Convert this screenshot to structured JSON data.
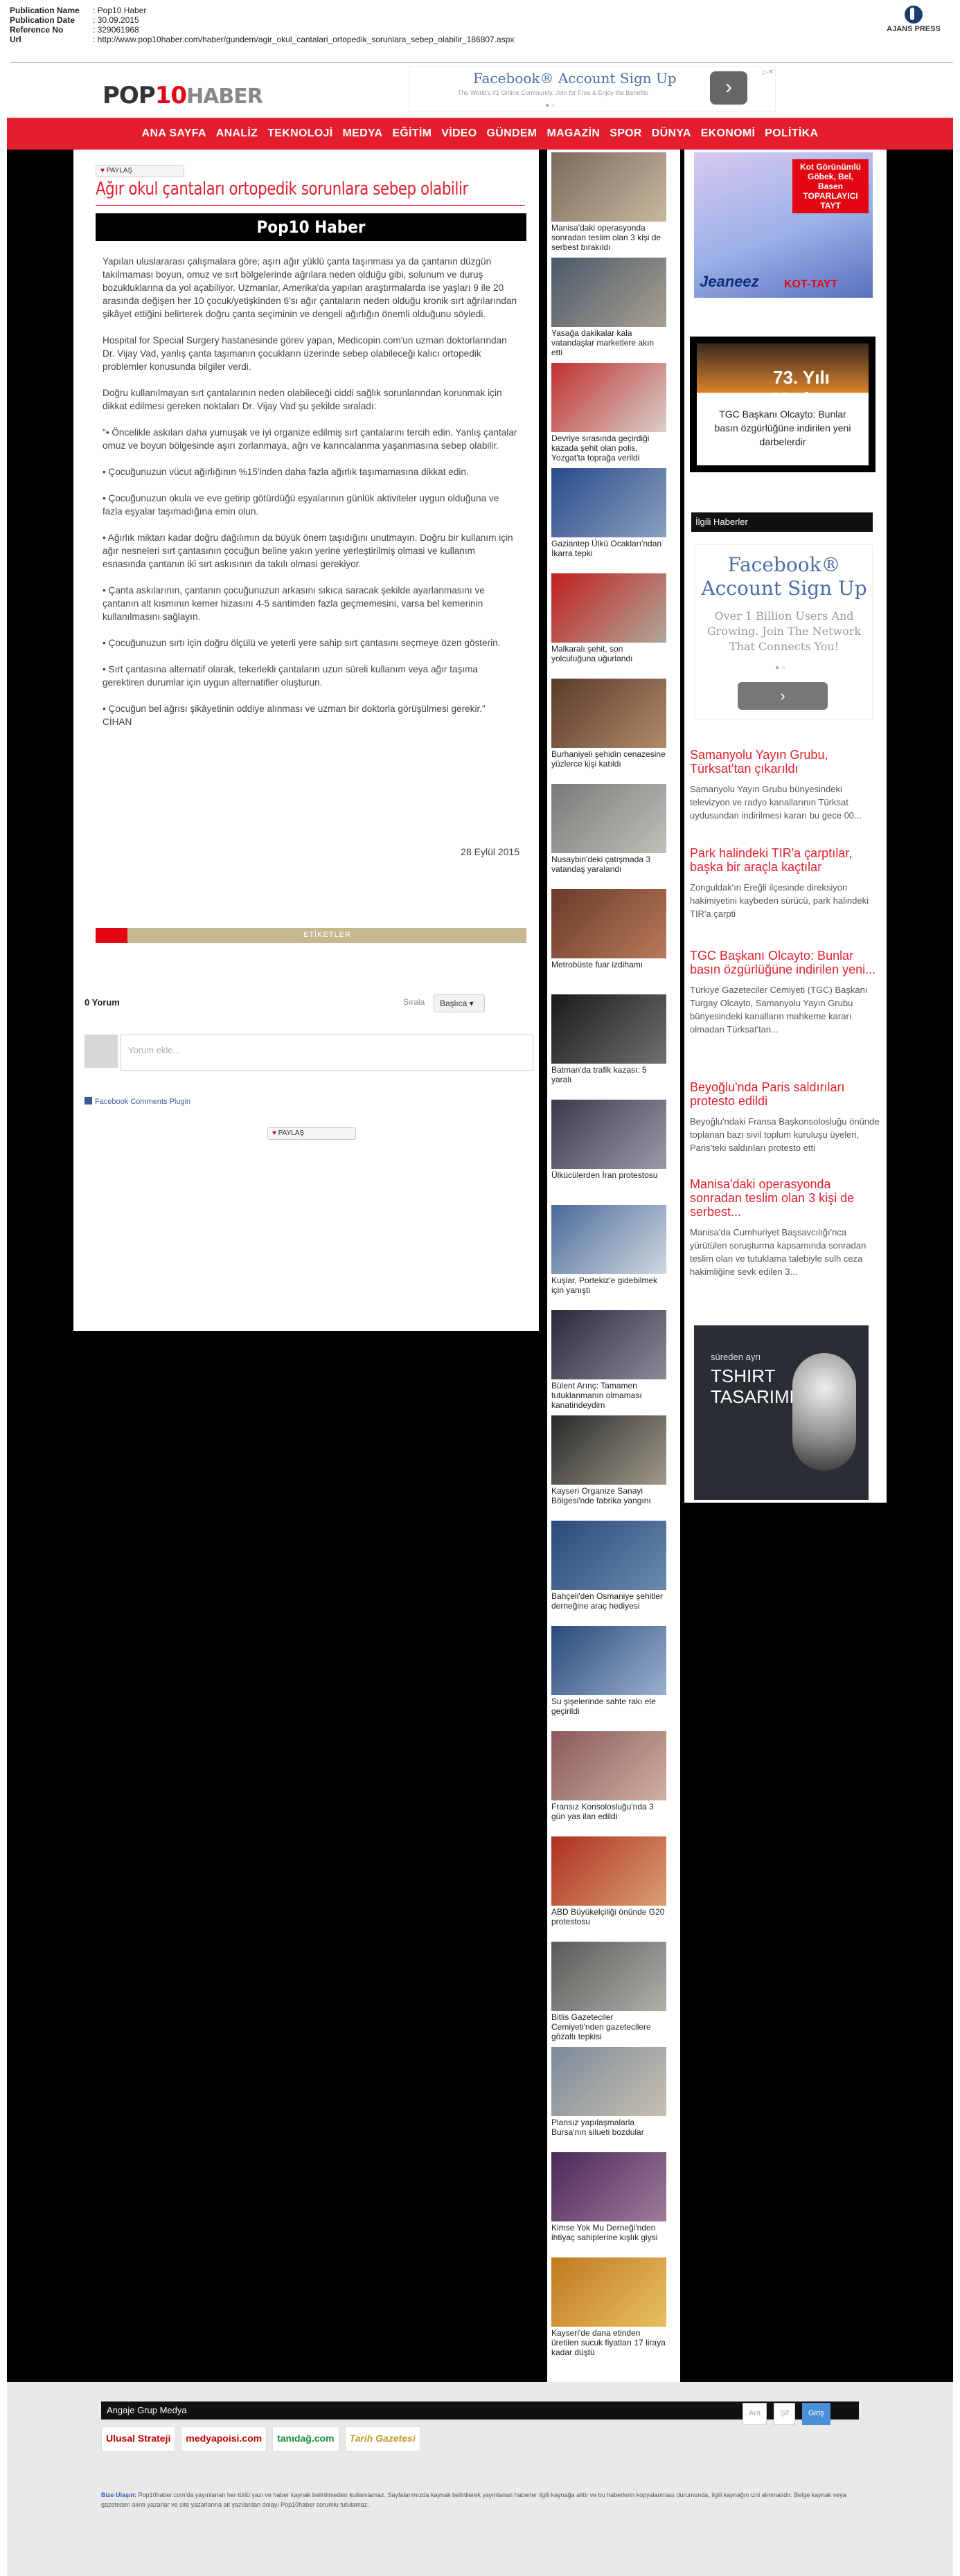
{
  "meta": {
    "rows": [
      {
        "key": "Publication Name",
        "value": ": Pop10 Haber"
      },
      {
        "key": "Publication Date",
        "value": ": 30.09.2015"
      },
      {
        "key": "Reference No",
        "value": ": 329061968"
      },
      {
        "key": "Url",
        "value": ": http://www.pop10haber.com/haber/gundem/agir_okul_cantalari_ortopedik_sorunlara_sebep_olabilir_186807.aspx"
      }
    ],
    "agency": "AJANS PRESS"
  },
  "site": {
    "logo_pop": "POP",
    "logo_10": "10",
    "logo_haber": "HABER"
  },
  "top_ad": {
    "title": "Facebook® Account Sign Up",
    "subtitle": "The World's #1 Online Community. Join for Free & Enjoy the Benefits",
    "button": "›",
    "dots": "● ○",
    "close": "▷✕"
  },
  "nav": [
    "ANA SAYFA",
    "ANALİZ",
    "TEKNOLOJİ",
    "MEDYA",
    "EĞİTİM",
    "VİDEO",
    "GÜNDEM",
    "MAGAZİN",
    "SPOR",
    "DÜNYA",
    "EKONOMİ",
    "POLİTİKA"
  ],
  "article": {
    "share_label": "PAYLAŞ",
    "title": "Ağır okul çantaları ortopedik sorunlara sebep olabilir",
    "brand": "Pop10 Haber",
    "paragraphs": [
      "Yapılan uluslararası çalışmalara göre; aşırı ağır yüklü çanta taşınması ya da çantanın düzgün takılmaması boyun, omuz ve sırt bölgelerinde ağrılara neden olduğu gibi, solunum ve duruş bozukluklarına da yol açabiliyor. Uzmanlar, Amerika'da yapılan araştırmalarda ise yaşları 9 ile 20 arasında değişen her 10 çocuk/yetişkinden 6'sı ağır çantaların neden olduğu kronik sırt ağrılarından şikâyet ettiğini belirterek doğru çanta seçiminin ve dengeli ağırlığın önemli olduğunu söyledi.",
      "Hospital for Special Surgery hastanesinde görev yapan, Medicopin.com'un uzman doktorlarından Dr. Vijay Vad, yanlış çanta taşımanın çocukların üzerinde sebep olabileceği kalıcı ortopedik problemler konusunda bilgiler verdi.",
      "Doğru kullanılmayan sırt çantalarının neden olabileceği ciddi sağlık sorunlarından korunmak için dikkat edilmesi gereken noktaları Dr. Vijay Vad şu şekilde sıraladı:",
      "\"• Öncelikle askıları daha yumuşak ve iyi organize edilmiş sırt çantalarını tercih edin. Yanlış çantalar omuz ve boyun bölgesinde aşırı zorlanmaya, ağrı ve karıncalanma yaşanmasına sebep olabilir.",
      "• Çocuğunuzun vücut ağırlığının %15'inden daha fazla ağırlık taşımamasına dikkat edin.",
      "• Çocuğunuzun okula ve eve getirip götürdüğü eşyalarının günlük aktiviteler uygun olduğuna ve fazla eşyalar taşımadığına emin olun.",
      "• Ağırlık miktarı kadar doğru dağılımın da büyük önem taşıdığını unutmayın. Doğru bir kullanım için ağır nesneleri sırt çantasının çocuğun beline yakın yerine yerleştirilmiş olmasi ve kullanım esnasında çantanın iki sırt askısının da takılı olmasi gerekiyor.",
      "• Çanta askılarının, çantanın çocuğunuzun arkasını sıkıca saracak şekilde ayarlanmasını ve çantanın alt kısmının kemer hizasını 4-5 santimden fazla geçmemesini, varsa bel kemerinin kullanılmasını sağlayın.",
      "• Çocuğunuzun sırtı için doğru ölçülü ve yeterli yere sahip sırt çantasını seçmeye özen gösterin.",
      "• Sırt çantasına alternatif olarak, tekerlekli çantaların uzun süreli kullanım veya ağır taşıma gerektiren durumlar için uygun alternatifler oluşturun.",
      "• Çocuğun bel ağrısı şikâyetinin oddiye alınması ve uzman bir doktorla görüşülmesi gerekir.\"\nCİHAN"
    ],
    "date": "28 Eylül 2015",
    "tags_label": "ETİKETLER"
  },
  "comments": {
    "count": "0 Yorum",
    "sort_label": "Sırala",
    "sort_value": "Başlıca ▾",
    "placeholder": "Yorum ekle...",
    "plugin": "Facebook Comments Plugin"
  },
  "middle_news": [
    {
      "caption": "Manisa'daki operasyonda sonradan teslim olan 3 kişi de serbest bırakıldı",
      "c1": "#7a6a5a",
      "c2": "#c9b8a0"
    },
    {
      "caption": "Yasağa dakikalar kala vatandaşlar marketlere akın etti",
      "c1": "#4a5a6a",
      "c2": "#a8a090"
    },
    {
      "caption": "Devriye sırasında geçirdiği kazada şehit olan polis, Yozgat'ta toprağa verildi",
      "c1": "#c03030",
      "c2": "#d8d0c8"
    },
    {
      "caption": "Gaziantep Ülkü Ocakları'ndan İkarra tepki",
      "c1": "#2a4a8a",
      "c2": "#8aa0c0"
    },
    {
      "caption": "Malkaralı şehit, son yolculuğuna uğurlandı",
      "c1": "#c02020",
      "c2": "#b0a898"
    },
    {
      "caption": "Burhaniyeli şehidin cenazesine yüzlerce kişi katıldı",
      "c1": "#5a3a2a",
      "c2": "#b08a6a"
    },
    {
      "caption": "Nusaybin'deki çatışmada 3 vatandaş yaralandı",
      "c1": "#7a7a7a",
      "c2": "#c0c0b8"
    },
    {
      "caption": "Metrobüste fuar izdihamı",
      "c1": "#6a3a2a",
      "c2": "#b87a5a"
    },
    {
      "caption": "Batman'da trafik kazası: 5 yaralı",
      "c1": "#1a1a1a",
      "c2": "#707070"
    },
    {
      "caption": "Ülkücülerden İran protestosu",
      "c1": "#3a3a4a",
      "c2": "#9a9aa8"
    },
    {
      "caption": "Kuşlar, Portekiz'e gidebilmek için yanıştı",
      "c1": "#4a6a9a",
      "c2": "#d0d8e0"
    },
    {
      "caption": "Bülent Arınç: Tamamen tutuklanmanın olmaması kanatindeydim",
      "c1": "#2a2a3a",
      "c2": "#8a8a9a"
    },
    {
      "caption": "Kayseri Organize Sanayi Bölgesi'nde fabrika yangını",
      "c1": "#2a2a2a",
      "c2": "#a09a8a"
    },
    {
      "caption": "Bahçeli'den Osmaniye şehitler derneğine araç hediyesi",
      "c1": "#2a4a7a",
      "c2": "#6a8ab0"
    },
    {
      "caption": "Su şişelerinde sahte rakı ele geçirildi",
      "c1": "#2a4a7a",
      "c2": "#9ab0d0"
    },
    {
      "caption": "Fransız Konsolosluğu'nda 3 gün yas ilan edildi",
      "c1": "#8a5a5a",
      "c2": "#d0b0a0"
    },
    {
      "caption": "ABD Büyükelçiliği önünde G20 protestosu",
      "c1": "#b03020",
      "c2": "#d8a070"
    },
    {
      "caption": "Bitlis Gazeteciler Cemiyeti'nden gazetecilere gözaltı tepkisi",
      "c1": "#5a5a5a",
      "c2": "#b0b0a8"
    },
    {
      "caption": "Plansız yapılaşmalarla Bursa'nın silueti bozdular",
      "c1": "#7a8a9a",
      "c2": "#c8c0b0"
    },
    {
      "caption": "Kimse Yok Mu Derneği'nden ihtiyaç sahiplerine kışlık giysi",
      "c1": "#4a2a5a",
      "c2": "#a07a9a"
    },
    {
      "caption": "Kayseri'de dana etinden üretilen sucuk fiyatları 17 liraya kadar düştü",
      "c1": "#c07a20",
      "c2": "#e8c060"
    }
  ],
  "right": {
    "jeans_ad": {
      "text": "Kot Görünümlü Göbek, Bel, Basen TOPARLAYICI TAYT",
      "logo": "Jeaneez",
      "brand": "KOT-TAYT"
    },
    "tgc_box": {
      "year": "73. Yılı Medya",
      "caption": "TGC Başkanı Olcayto: Bunlar basın özgürlüğüne indirilen yeni darbelerdir"
    },
    "related_label": "İlgili Haberler",
    "fb_ad": {
      "title": "Facebook® Account Sign Up",
      "subtitle": "Over 1 Billion Users And Growing. Join The Network That Connects You!",
      "dots": "● ○",
      "button": "›"
    },
    "news": [
      {
        "headline": "Samanyolu Yayın Grubu, Türksat'tan çıkarıldı",
        "summary": "Samanyolu Yayın Grubu bünyesindeki televizyon ve radyo kanallarının Türksat uydusundan indirilmesi kararı bu gece 00..."
      },
      {
        "headline": "Park halindeki TIR'a çarptılar, başka bir araçla kaçtılar",
        "summary": "Zonguldak'ın Ereğli ilçesinde direksiyon hakimiyetini kaybeden sürücü, park halindeki TIR'a çarpti"
      },
      {
        "headline": "TGC Başkanı Olcayto: Bunlar basın özgürlüğüne indirilen yeni...",
        "summary": "Türkiye Gazeteciler Cemiyeti (TGC) Başkanı Turgay Olcayto, Samanyolu Yayın Grubu bünyesindeki kanalların mahkeme kararı olmadan Türksat'tan..."
      },
      {
        "headline": "Beyoğlu'nda Paris saldırıları protesto edildi",
        "summary": "Beyoğlu'ndaki Fransa Başkonsolosluğu önünde toplanan bazı sivil toplum kuruluşu üyeleri, Paris'teki saldırıları protesto etti"
      },
      {
        "headline": "Manisa'daki operasyonda sonradan teslim olan 3 kişi de serbest...",
        "summary": "Manisa'da Cumhuriyet Başsavcılığı'nca yürütülen soruşturma kapsamında sonradan teslim olan ve tutuklama talebiyle sulh ceza hakimliğine sevk edilen 3..."
      }
    ],
    "shirt_ad": {
      "line1": "süreden ayrı",
      "line2": "TSHIRT TASARIMLARI"
    }
  },
  "footer": {
    "group": "Angaje Grup Medya",
    "search_placeholder": "Ara",
    "search_placeholder2": "Şif",
    "search_button": "Giriş",
    "logos": [
      "Ulusal Strateji",
      "medyapoisi.com",
      "tanıdağ.com",
      "Tarih Gazetesi"
    ],
    "contact_label": "Bize Ulaşın:",
    "contact_text": "Pop10haber.com'da yayınlanan her türlü yazı ve haber kaynak belirtilmeden kullanılamaz. Sayfalarımızda kaynak belirtilerek yayınlanan haberler ilgili kaynağa aittir ve bu haberlerin kopyalanması durumunda, ilgili kaynağın izni alınmalıdır. Belge kaynak veya gazeteden alıntı yazarlar ve site yazarlarına ait yazılardan dolayı Pop10haber sorumlu tutulamaz."
  }
}
